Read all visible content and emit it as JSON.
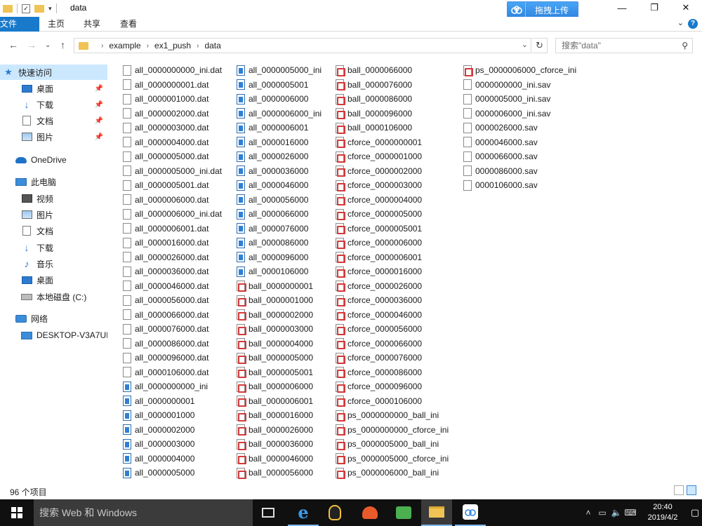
{
  "window": {
    "title": "data"
  },
  "toolbar": {
    "upload_label": "拖拽上传"
  },
  "ribbon": {
    "tabs": [
      "文件",
      "主页",
      "共享",
      "查看"
    ]
  },
  "address": {
    "crumbs": [
      "example",
      "ex1_push",
      "data"
    ],
    "search_placeholder": "搜索\"data\""
  },
  "nav": {
    "quick_access": "快速访问",
    "items_pinned": [
      {
        "label": "桌面",
        "icon": "desktop-icon"
      },
      {
        "label": "下载",
        "icon": "download-icon"
      },
      {
        "label": "文档",
        "icon": "document-icon"
      },
      {
        "label": "图片",
        "icon": "picture-icon"
      }
    ],
    "onedrive": "OneDrive",
    "this_pc": "此电脑",
    "pc_items": [
      {
        "label": "视频",
        "icon": "video-icon"
      },
      {
        "label": "图片",
        "icon": "picture-icon"
      },
      {
        "label": "文档",
        "icon": "document-icon"
      },
      {
        "label": "下载",
        "icon": "download-icon"
      },
      {
        "label": "音乐",
        "icon": "music-icon"
      },
      {
        "label": "桌面",
        "icon": "desktop-icon"
      },
      {
        "label": "本地磁盘 (C:)",
        "icon": "disk-icon"
      }
    ],
    "network": "网络",
    "network_items": [
      "DESKTOP-V3A7UI"
    ]
  },
  "files": {
    "columns": [
      [
        {
          "name": "all_0000000000_ini.dat",
          "type": "dat"
        },
        {
          "name": "all_0000000001.dat",
          "type": "dat"
        },
        {
          "name": "all_0000001000.dat",
          "type": "dat"
        },
        {
          "name": "all_0000002000.dat",
          "type": "dat"
        },
        {
          "name": "all_0000003000.dat",
          "type": "dat"
        },
        {
          "name": "all_0000004000.dat",
          "type": "dat"
        },
        {
          "name": "all_0000005000.dat",
          "type": "dat"
        },
        {
          "name": "all_0000005000_ini.dat",
          "type": "dat"
        },
        {
          "name": "all_0000005001.dat",
          "type": "dat"
        },
        {
          "name": "all_0000006000.dat",
          "type": "dat"
        },
        {
          "name": "all_0000006000_ini.dat",
          "type": "dat"
        },
        {
          "name": "all_0000006001.dat",
          "type": "dat"
        },
        {
          "name": "all_0000016000.dat",
          "type": "dat"
        },
        {
          "name": "all_0000026000.dat",
          "type": "dat"
        },
        {
          "name": "all_0000036000.dat",
          "type": "dat"
        },
        {
          "name": "all_0000046000.dat",
          "type": "dat"
        },
        {
          "name": "all_0000056000.dat",
          "type": "dat"
        },
        {
          "name": "all_0000066000.dat",
          "type": "dat"
        },
        {
          "name": "all_0000076000.dat",
          "type": "dat"
        },
        {
          "name": "all_0000086000.dat",
          "type": "dat"
        },
        {
          "name": "all_0000096000.dat",
          "type": "dat"
        },
        {
          "name": "all_0000106000.dat",
          "type": "dat"
        },
        {
          "name": "all_0000000000_ini",
          "type": "blue"
        },
        {
          "name": "all_0000000001",
          "type": "blue"
        },
        {
          "name": "all_0000001000",
          "type": "blue"
        },
        {
          "name": "all_0000002000",
          "type": "blue"
        },
        {
          "name": "all_0000003000",
          "type": "blue"
        },
        {
          "name": "all_0000004000",
          "type": "blue"
        },
        {
          "name": "all_0000005000",
          "type": "blue"
        }
      ],
      [
        {
          "name": "all_0000005000_ini",
          "type": "blue"
        },
        {
          "name": "all_0000005001",
          "type": "blue"
        },
        {
          "name": "all_0000006000",
          "type": "blue"
        },
        {
          "name": "all_0000006000_ini",
          "type": "blue"
        },
        {
          "name": "all_0000006001",
          "type": "blue"
        },
        {
          "name": "all_0000016000",
          "type": "blue"
        },
        {
          "name": "all_0000026000",
          "type": "blue"
        },
        {
          "name": "all_0000036000",
          "type": "blue"
        },
        {
          "name": "all_0000046000",
          "type": "blue"
        },
        {
          "name": "all_0000056000",
          "type": "blue"
        },
        {
          "name": "all_0000066000",
          "type": "blue"
        },
        {
          "name": "all_0000076000",
          "type": "blue"
        },
        {
          "name": "all_0000086000",
          "type": "blue"
        },
        {
          "name": "all_0000096000",
          "type": "blue"
        },
        {
          "name": "all_0000106000",
          "type": "blue"
        },
        {
          "name": "ball_0000000001",
          "type": "red"
        },
        {
          "name": "ball_0000001000",
          "type": "red"
        },
        {
          "name": "ball_0000002000",
          "type": "red"
        },
        {
          "name": "ball_0000003000",
          "type": "red"
        },
        {
          "name": "ball_0000004000",
          "type": "red"
        },
        {
          "name": "ball_0000005000",
          "type": "red"
        },
        {
          "name": "ball_0000005001",
          "type": "red"
        },
        {
          "name": "ball_0000006000",
          "type": "red"
        },
        {
          "name": "ball_0000006001",
          "type": "red"
        },
        {
          "name": "ball_0000016000",
          "type": "red"
        },
        {
          "name": "ball_0000026000",
          "type": "red"
        },
        {
          "name": "ball_0000036000",
          "type": "red"
        },
        {
          "name": "ball_0000046000",
          "type": "red"
        },
        {
          "name": "ball_0000056000",
          "type": "red"
        }
      ],
      [
        {
          "name": "ball_0000066000",
          "type": "red"
        },
        {
          "name": "ball_0000076000",
          "type": "red"
        },
        {
          "name": "ball_0000086000",
          "type": "red"
        },
        {
          "name": "ball_0000096000",
          "type": "red"
        },
        {
          "name": "ball_0000106000",
          "type": "red"
        },
        {
          "name": "cforce_0000000001",
          "type": "red"
        },
        {
          "name": "cforce_0000001000",
          "type": "red"
        },
        {
          "name": "cforce_0000002000",
          "type": "red"
        },
        {
          "name": "cforce_0000003000",
          "type": "red"
        },
        {
          "name": "cforce_0000004000",
          "type": "red"
        },
        {
          "name": "cforce_0000005000",
          "type": "red"
        },
        {
          "name": "cforce_0000005001",
          "type": "red"
        },
        {
          "name": "cforce_0000006000",
          "type": "red"
        },
        {
          "name": "cforce_0000006001",
          "type": "red"
        },
        {
          "name": "cforce_0000016000",
          "type": "red"
        },
        {
          "name": "cforce_0000026000",
          "type": "red"
        },
        {
          "name": "cforce_0000036000",
          "type": "red"
        },
        {
          "name": "cforce_0000046000",
          "type": "red"
        },
        {
          "name": "cforce_0000056000",
          "type": "red"
        },
        {
          "name": "cforce_0000066000",
          "type": "red"
        },
        {
          "name": "cforce_0000076000",
          "type": "red"
        },
        {
          "name": "cforce_0000086000",
          "type": "red"
        },
        {
          "name": "cforce_0000096000",
          "type": "red"
        },
        {
          "name": "cforce_0000106000",
          "type": "red"
        },
        {
          "name": "ps_0000000000_ball_ini",
          "type": "red"
        },
        {
          "name": "ps_0000000000_cforce_ini",
          "type": "red"
        },
        {
          "name": "ps_0000005000_ball_ini",
          "type": "red"
        },
        {
          "name": "ps_0000005000_cforce_ini",
          "type": "red"
        },
        {
          "name": "ps_0000006000_ball_ini",
          "type": "red"
        }
      ],
      [
        {
          "name": "ps_0000006000_cforce_ini",
          "type": "red"
        },
        {
          "name": "0000000000_ini.sav",
          "type": "dat"
        },
        {
          "name": "0000005000_ini.sav",
          "type": "dat"
        },
        {
          "name": "0000006000_ini.sav",
          "type": "dat"
        },
        {
          "name": "0000026000.sav",
          "type": "dat"
        },
        {
          "name": "0000046000.sav",
          "type": "dat"
        },
        {
          "name": "0000066000.sav",
          "type": "dat"
        },
        {
          "name": "0000086000.sav",
          "type": "dat"
        },
        {
          "name": "0000106000.sav",
          "type": "dat"
        }
      ]
    ]
  },
  "status": {
    "count": "96 个项目"
  },
  "taskbar": {
    "search_placeholder": "搜索 Web 和 Windows",
    "time": "20:40",
    "date": "2019/4/2"
  }
}
